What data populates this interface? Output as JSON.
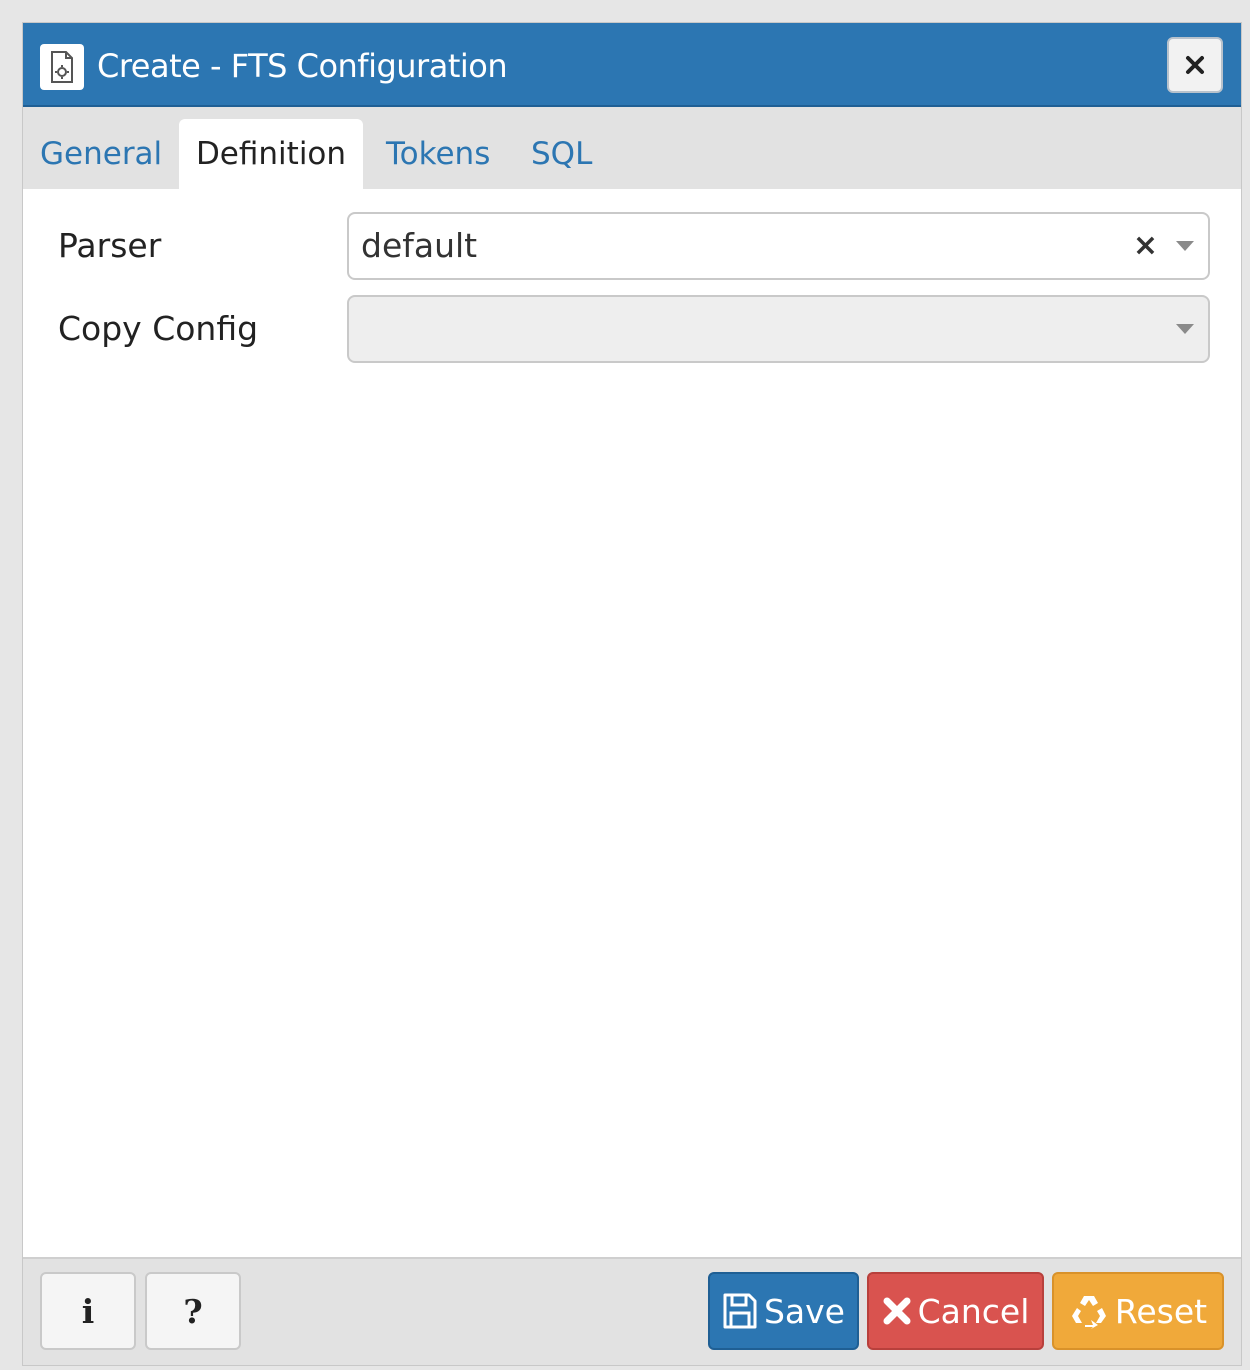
{
  "dialog": {
    "title": "Create - FTS Configuration",
    "icon": "fts-configuration-icon",
    "close_icon": "close-icon"
  },
  "tabs": [
    {
      "label": "General",
      "active": false
    },
    {
      "label": "Definition",
      "active": true
    },
    {
      "label": "Tokens",
      "active": false
    },
    {
      "label": "SQL",
      "active": false
    }
  ],
  "form": {
    "parser": {
      "label": "Parser",
      "value": "default",
      "clear_symbol": "×"
    },
    "copy_config": {
      "label": "Copy Config",
      "value": ""
    }
  },
  "footer": {
    "info_label": "i",
    "help_label": "?",
    "save_label": "Save",
    "cancel_label": "Cancel",
    "reset_label": "Reset"
  },
  "colors": {
    "titlebar": "#2c76b2",
    "tab_link": "#2c76b2",
    "save": "#2c76b2",
    "cancel": "#d9534f",
    "reset": "#f0a93a"
  }
}
